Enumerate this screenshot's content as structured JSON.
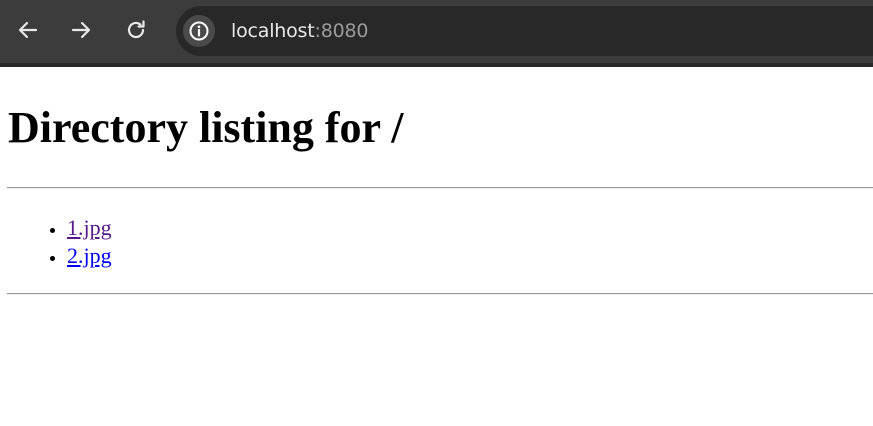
{
  "browser": {
    "url_host": "localhost",
    "url_port": ":8080",
    "back_icon": "arrow-left-icon",
    "forward_icon": "arrow-right-icon",
    "reload_icon": "reload-icon",
    "site_info_icon": "info-icon"
  },
  "page": {
    "heading": "Directory listing for /",
    "files": [
      {
        "name": "1.jpg",
        "link_color": "#551a8b"
      },
      {
        "name": "2.jpg",
        "link_color": "#0000ee"
      }
    ]
  },
  "colors": {
    "toolbar_bg": "#3c3c3c",
    "omnibox_bg": "#282828"
  }
}
